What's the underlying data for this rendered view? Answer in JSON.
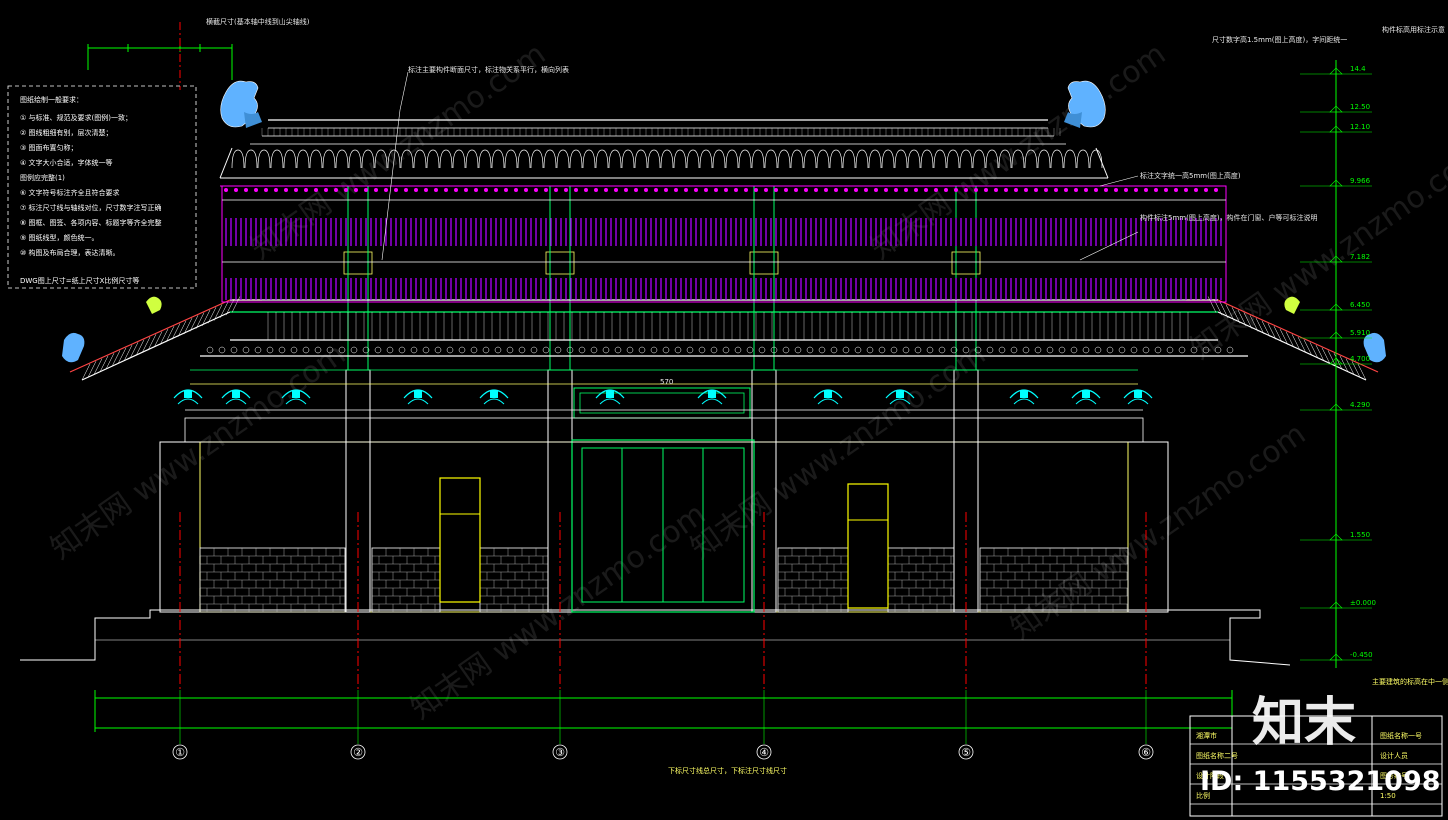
{
  "drawing": {
    "top_note": "横截尺寸(基本轴中线到山尖轴线)",
    "ridge_note": "标注主要构件断面尺寸，标注物关系平行，横向列表",
    "right_note_1": "尺寸数字高1.5mm(图上高度)，字间距统一",
    "right_note_2": "构件标高用标注示意",
    "right_note_3": "标注文字统一高5mm(图上高度)",
    "right_note_4": "构件标注5mm(图上高度)，构件在门窗、户等可标注说明",
    "left_note_title": "图纸绘制一般要求：",
    "left_note_items": [
      "① 与标准、规范及要求(图例)一致；",
      "② 图线粗细有别，层次清楚；",
      "③ 图面布置匀称；",
      "④ 文字大小合适，字体统一等",
      "图例应完整(1)",
      "⑥ 文字符号标注齐全且符合要求",
      "⑦ 标注尺寸线与轴线对位，尺寸数字注写正确",
      "⑧ 图框、图签、各项内容、标题字等齐全完整",
      "⑨ 图纸线型，颜色统一。",
      "⑩ 构图及布局合理，表达清晰。"
    ],
    "left_note_footer": "DWG图上尺寸=纸上尺寸X比例尺寸等",
    "center_dim": "570",
    "bottom_note": "下标尺寸线总尺寸，下标注尺寸线尺寸",
    "bottom_right_note": "主要建筑的标高在中一侧，注意标注尺寸",
    "axes": [
      "①",
      "②",
      "③",
      "④",
      "⑤",
      "⑥"
    ],
    "elevations": [
      "14.4",
      "12.50",
      "12.10",
      "9.966",
      "7.182",
      "6.450",
      "5.910",
      "4.700",
      "4.290",
      "1.550",
      "±0.000",
      "-0.450"
    ],
    "title_block": [
      "湘潭市",
      "图纸名称一号",
      "图纸名称二号",
      "设计人员",
      "设计阶段",
      "图号编号",
      "比例",
      "1:50"
    ]
  },
  "brand": {
    "logo_text": "知末",
    "id_text": "ID: 1155321098",
    "watermark": "知末网 www.znzmo.com"
  },
  "colors": {
    "bg": "#000000",
    "white": "#ffffff",
    "yellow": "#ffff00",
    "green": "#00ff00",
    "cyan": "#00ffff",
    "magenta": "#ff00ff",
    "purple": "#b000ff",
    "red": "#ff0000",
    "blue": "#3fa9ff"
  }
}
